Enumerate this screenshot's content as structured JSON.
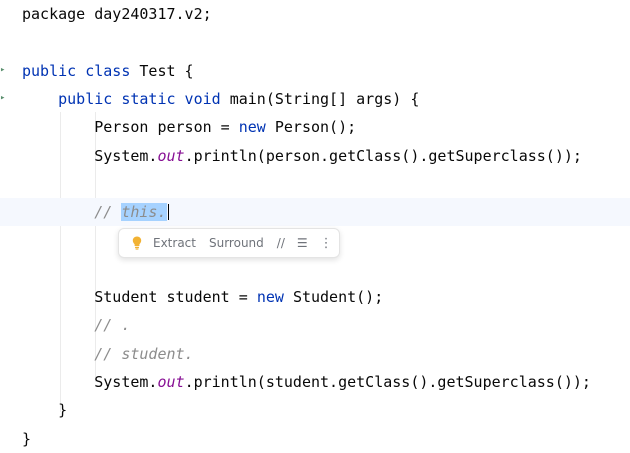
{
  "editor": {
    "lines": [
      {
        "tokens": [
          {
            "t": "package ",
            "c": "plain"
          },
          {
            "t": "day240317.v2;",
            "c": "plain"
          }
        ]
      },
      {
        "tokens": []
      },
      {
        "tokens": [
          {
            "t": "public class ",
            "c": "kw"
          },
          {
            "t": "Test {",
            "c": "plain"
          }
        ]
      },
      {
        "tokens": [
          {
            "t": "    public static void ",
            "c": "kw"
          },
          {
            "t": "main(String[] args) {",
            "c": "plain"
          }
        ]
      },
      {
        "tokens": [
          {
            "t": "        Person person = ",
            "c": "plain"
          },
          {
            "t": "new ",
            "c": "kw"
          },
          {
            "t": "Person();",
            "c": "plain"
          }
        ]
      },
      {
        "tokens": [
          {
            "t": "        System.",
            "c": "plain"
          },
          {
            "t": "out",
            "c": "field-static"
          },
          {
            "t": ".println(person.getClass().getSuperclass());",
            "c": "plain"
          }
        ]
      },
      {
        "tokens": []
      },
      {
        "tokens": [
          {
            "t": "        // ",
            "c": "comment"
          },
          {
            "t": "this.",
            "c": "sel"
          }
        ],
        "current": true,
        "caret": true
      },
      {
        "tokens": []
      },
      {
        "tokens": []
      },
      {
        "tokens": [
          {
            "t": "        Student student = ",
            "c": "plain"
          },
          {
            "t": "new ",
            "c": "kw"
          },
          {
            "t": "Student();",
            "c": "plain"
          }
        ]
      },
      {
        "tokens": [
          {
            "t": "        // .",
            "c": "comment"
          }
        ]
      },
      {
        "tokens": [
          {
            "t": "        // student.",
            "c": "comment"
          }
        ]
      },
      {
        "tokens": [
          {
            "t": "        System.",
            "c": "plain"
          },
          {
            "t": "out",
            "c": "field-static"
          },
          {
            "t": ".println(student.getClass().getSuperclass());",
            "c": "plain"
          }
        ]
      },
      {
        "tokens": [
          {
            "t": "    }",
            "c": "plain"
          }
        ]
      },
      {
        "tokens": [
          {
            "t": "}",
            "c": "plain"
          }
        ]
      }
    ]
  },
  "popup": {
    "icon": "lightbulb-icon",
    "extract_label": "Extract",
    "surround_label": "Surround",
    "comment_icon": "comment-icon",
    "comment_glyph": "//",
    "format_icon": "reformat-icon",
    "format_glyph": "☰",
    "more_icon": "more-vertical-icon",
    "more_glyph": "⋮"
  },
  "colors": {
    "keyword": "#0033b3",
    "comment": "#8c8c8c",
    "static_field": "#871094",
    "selection": "#a6d2ff",
    "current_line": "#f5f8fe"
  }
}
